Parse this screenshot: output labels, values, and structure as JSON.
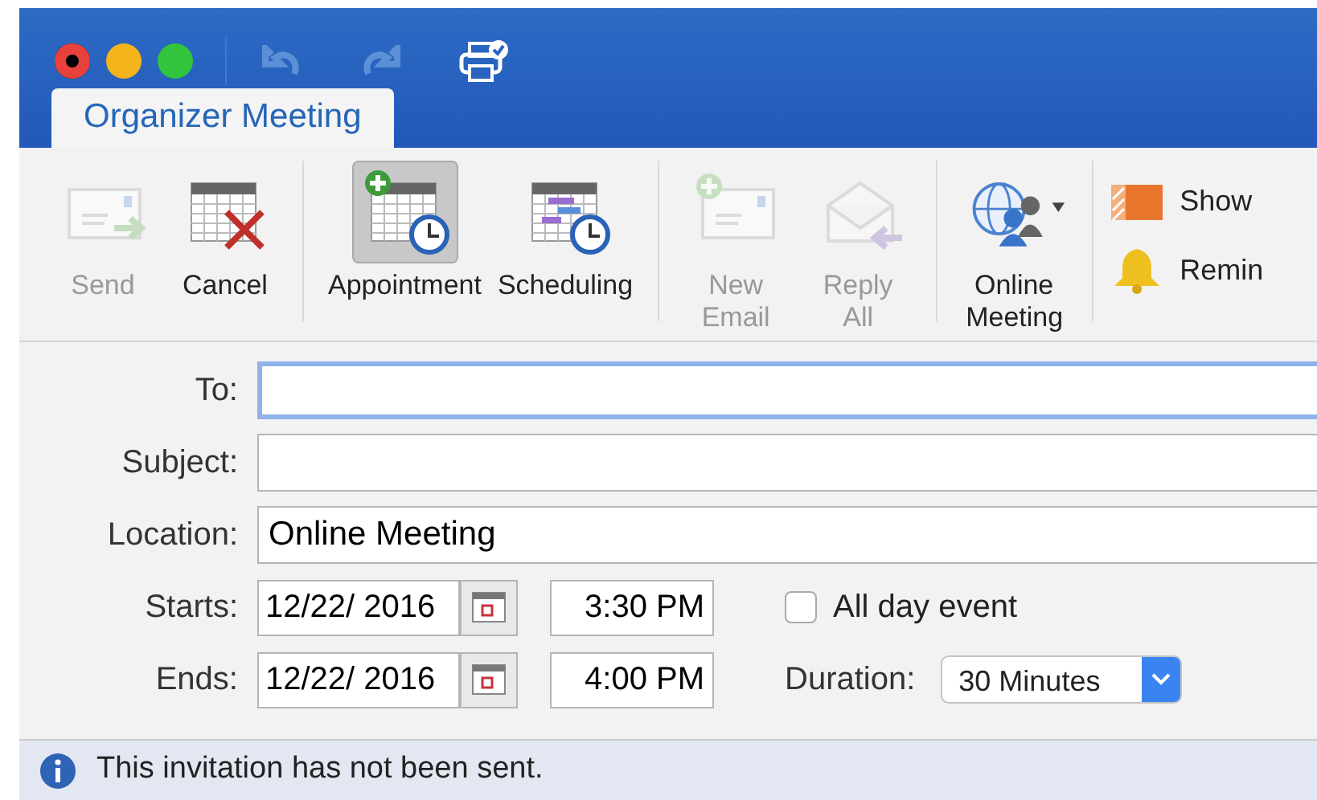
{
  "tabs": [
    {
      "label": "Organizer Meeting",
      "selected": true
    }
  ],
  "ribbon": [
    [
      {
        "label": "Send",
        "disabled": true,
        "selected": false
      },
      {
        "label": "Cancel",
        "disabled": false,
        "selected": false
      }
    ],
    [
      {
        "label": "Appointment",
        "disabled": false,
        "selected": true
      },
      {
        "label": "Scheduling",
        "disabled": false,
        "selected": false
      }
    ],
    [
      {
        "label": "New Email",
        "disabled": true,
        "selected": false
      },
      {
        "label": "Reply All",
        "disabled": true,
        "selected": false
      }
    ],
    [
      {
        "label": "Online Meeting",
        "disabled": false,
        "selected": false
      }
    ]
  ],
  "ribbon_side": [
    {
      "label": "Show"
    },
    {
      "label": "Remin"
    }
  ],
  "form": {
    "to": {
      "label": "To:",
      "focused": true
    },
    "subject": {
      "label": "Subject:"
    },
    "location": {
      "label": "Location:",
      "value": "Online Meeting"
    },
    "starts": {
      "label": "Starts:",
      "date": "12/22/ 2016",
      "time": "3:30 PM"
    },
    "ends": {
      "label": "Ends:",
      "date": "12/22/ 2016",
      "time": "4:00 PM"
    },
    "all_day": {
      "label": "All day event",
      "checked": false
    },
    "duration": {
      "label": "Duration:",
      "value": "30 Minutes"
    }
  },
  "info_bar": {
    "message": "This invitation has not been sent."
  }
}
